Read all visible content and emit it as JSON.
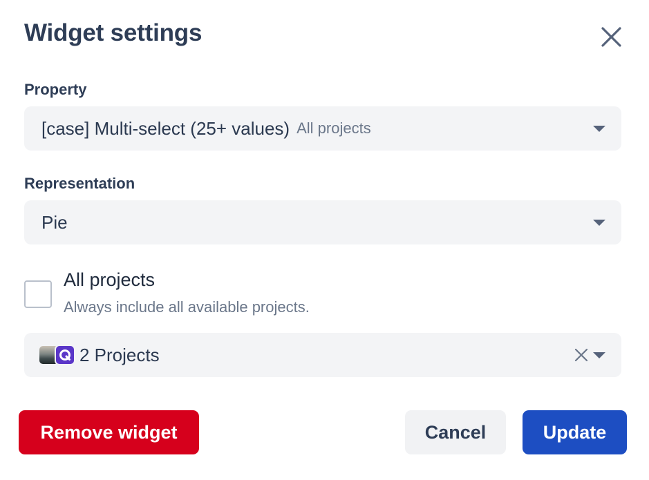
{
  "dialog": {
    "title": "Widget settings"
  },
  "property": {
    "label": "Property",
    "value": "[case] Multi-select (25+ values)",
    "scope": "All projects"
  },
  "representation": {
    "label": "Representation",
    "value": "Pie"
  },
  "all_projects": {
    "label": "All projects",
    "description": "Always include all available projects.",
    "checked": false
  },
  "projects": {
    "value": "2 Projects",
    "logo_letter": "Q"
  },
  "buttons": {
    "remove": "Remove widget",
    "cancel": "Cancel",
    "update": "Update"
  },
  "colors": {
    "danger": "#d6001c",
    "primary": "#1d4ec2",
    "field_bg": "#f3f4f6",
    "logo": "#5a36c8"
  }
}
